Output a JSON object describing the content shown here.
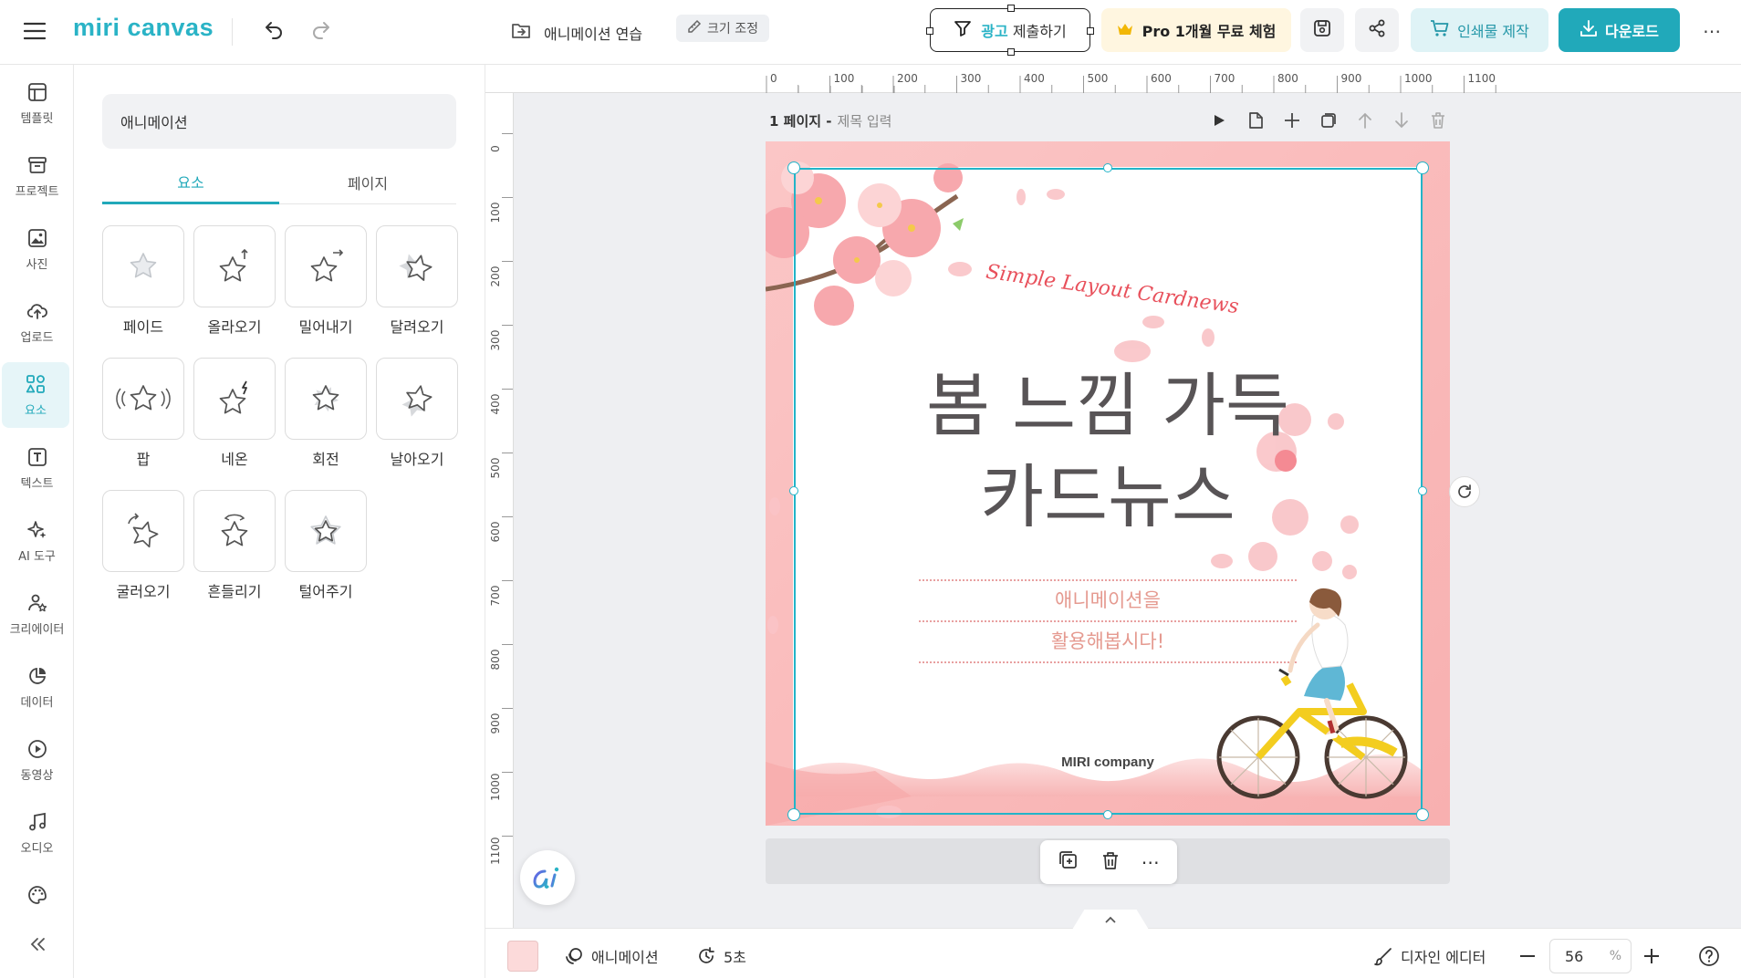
{
  "app": {
    "logo": "miri canvas"
  },
  "header": {
    "project_name": "애니메이션 연습",
    "resize_label": "크기 조정",
    "ad_submit_prefix": "광고",
    "ad_submit_suffix": "제출하기",
    "pro_trial_label": "Pro 1개월 무료 체험",
    "print_label": "인쇄물 제작",
    "download_label": "다운로드"
  },
  "rail": {
    "items": [
      {
        "label": "템플릿",
        "icon": "template-icon"
      },
      {
        "label": "프로젝트",
        "icon": "project-icon"
      },
      {
        "label": "사진",
        "icon": "photo-icon"
      },
      {
        "label": "업로드",
        "icon": "upload-icon"
      },
      {
        "label": "요소",
        "icon": "elements-icon",
        "active": true
      },
      {
        "label": "텍스트",
        "icon": "text-icon"
      },
      {
        "label": "AI 도구",
        "icon": "ai-tools-icon"
      },
      {
        "label": "크리에이터",
        "icon": "creator-icon"
      },
      {
        "label": "데이터",
        "icon": "data-icon"
      },
      {
        "label": "동영상",
        "icon": "video-icon"
      },
      {
        "label": "오디오",
        "icon": "audio-icon"
      },
      {
        "label": "",
        "icon": "palette-icon"
      }
    ]
  },
  "panel": {
    "search_value": "애니메이션",
    "tabs": [
      {
        "label": "요소",
        "active": true
      },
      {
        "label": "페이지",
        "active": false
      }
    ],
    "animations": [
      {
        "label": "페이드"
      },
      {
        "label": "올라오기"
      },
      {
        "label": "밀어내기"
      },
      {
        "label": "달려오기"
      },
      {
        "label": "팝"
      },
      {
        "label": "네온"
      },
      {
        "label": "회전"
      },
      {
        "label": "날아오기"
      },
      {
        "label": "굴러오기"
      },
      {
        "label": "흔들리기"
      },
      {
        "label": "털어주기"
      }
    ]
  },
  "ruler": {
    "top": [
      "0",
      "100",
      "200",
      "300",
      "400",
      "500",
      "600",
      "700",
      "800",
      "900",
      "1000",
      "1100"
    ],
    "left": [
      "0",
      "100",
      "200",
      "300",
      "400",
      "500",
      "600",
      "700",
      "800",
      "900",
      "1000",
      "1100"
    ]
  },
  "page": {
    "page_label": "1 페이지 -",
    "title_placeholder": "제목 입력",
    "script_text": "Simple Layout Cardnews",
    "headline_line1": "봄 느낌 가득",
    "headline_line2": "카드뉴스",
    "subtitle_line1": "애니메이션을",
    "subtitle_line2": "활용해봅시다!",
    "company": "MIRI company"
  },
  "bottom": {
    "animation_label": "애니메이션",
    "duration_label": "5초",
    "design_editor_label": "디자인 에디터",
    "zoom_value": "56",
    "zoom_unit": "%"
  },
  "colors": {
    "accent": "#21a9ba",
    "page_border_pink": "#f9b8b8",
    "bg_swatch": "#fcdada"
  }
}
